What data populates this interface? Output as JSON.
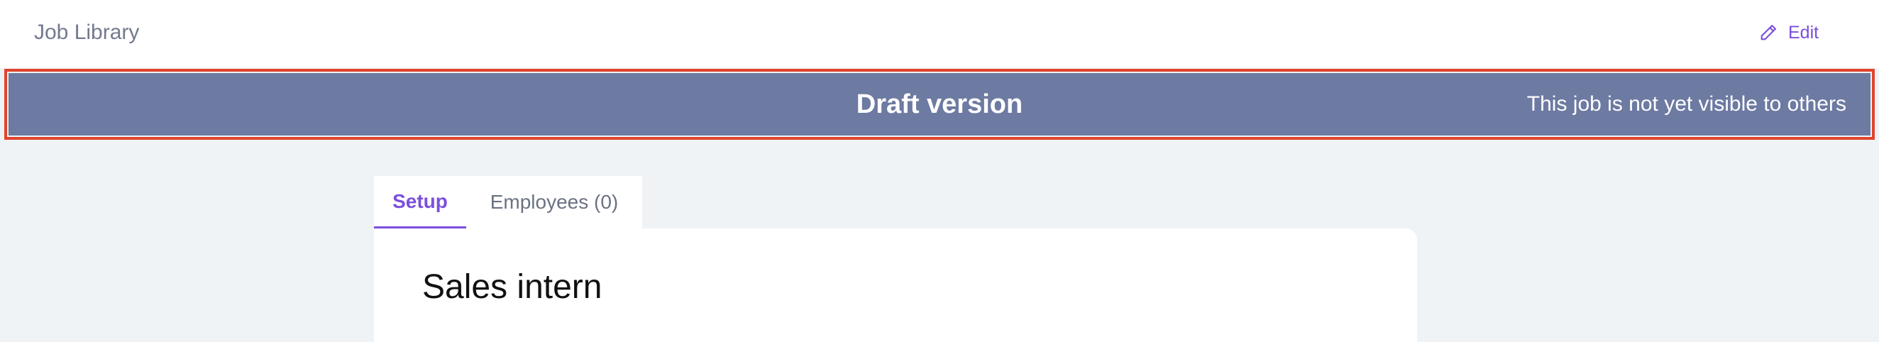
{
  "header": {
    "breadcrumb": "Job Library",
    "edit_label": "Edit",
    "edit_icon": "pencil-icon"
  },
  "banner": {
    "title": "Draft version",
    "note": "This job is not yet visible to others",
    "background_color": "#6d7aa2",
    "highlight_color": "#e0442d"
  },
  "tabs": [
    {
      "label": "Setup",
      "active": true
    },
    {
      "label": "Employees (0)",
      "active": false
    }
  ],
  "job": {
    "title": "Sales intern"
  },
  "colors": {
    "accent": "#7b4fdc",
    "page_background": "#f0f3f5"
  }
}
